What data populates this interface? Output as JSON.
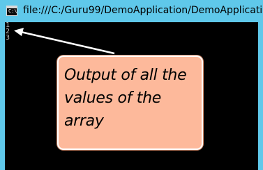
{
  "window": {
    "title": "file:///C:/Guru99/DemoApplication/DemoApplicatio",
    "icon": "console-icon",
    "icon_prompt": "C:\\"
  },
  "console": {
    "lines": [
      "1",
      "2",
      "3"
    ]
  },
  "annotation": {
    "text": "Output of all  the values of the array",
    "background_color": "#fdb99b",
    "arrow_color": "#ffffff"
  }
}
